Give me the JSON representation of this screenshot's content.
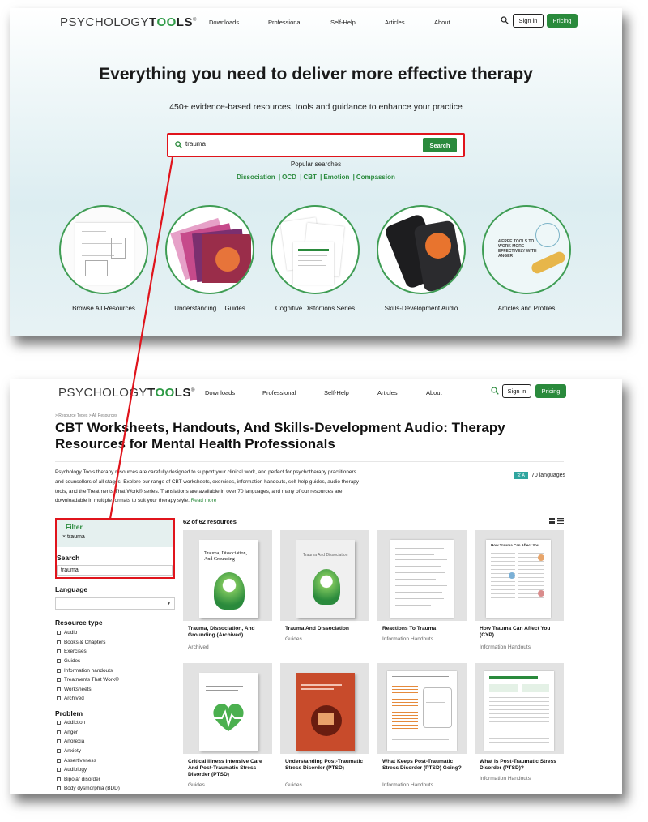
{
  "brand": {
    "logo_thin": "PSYCHOLOGY",
    "logo_bold_a": "T",
    "logo_oo": "OO",
    "logo_bold_b": "LS",
    "reg": "®"
  },
  "nav": {
    "downloads": "Downloads",
    "professional": "Professional",
    "self_help": "Self-Help",
    "articles": "Articles",
    "about": "About",
    "sign_in": "Sign in",
    "pricing": "Pricing"
  },
  "hero": {
    "title": "Everything you need to deliver more effective therapy",
    "subtitle": "450+ evidence-based resources, tools and guidance to enhance your practice",
    "search_value": "trauma",
    "search_button": "Search",
    "popular_label": "Popular searches",
    "popular": [
      "Dissociation",
      "OCD",
      "CBT",
      "Emotion",
      "Compassion"
    ]
  },
  "features": [
    {
      "label": "Browse All Resources"
    },
    {
      "label": "Understanding… Guides"
    },
    {
      "label": "Cognitive Distortions Series"
    },
    {
      "label": "Skills-Development Audio"
    },
    {
      "label": "Articles and Profiles",
      "promo": "4 FREE TOOLS TO WORK MORE EFFECTIVELY WITH ANGER"
    }
  ],
  "results_page": {
    "breadcrumb": "> Resource Types > All Resources",
    "title": "CBT Worksheets, Handouts, And Skills-Development Audio: Therapy Resources for Mental Health Professionals",
    "intro": "Psychology Tools therapy resources are carefully designed to support your clinical work, and perfect for psychotherapy practitioners and counsellors of all stages. Explore our range of CBT worksheets, exercises, information handouts, self-help guides, audio therapy tools, and the Treatments That Work® series. Translations are available in over 70 languages, and many of our resources are downloadable in multiple formats to suit your therapy style.",
    "read_more": "Read more",
    "languages": "70 languages",
    "lang_badge": "文 A",
    "filter_title": "Filter",
    "filter_chip": "× trauma",
    "search_label": "Search",
    "search_value": "trauma",
    "language_label": "Language",
    "resource_type_label": "Resource type",
    "resource_types": [
      "Audio",
      "Books & Chapters",
      "Exercises",
      "Guides",
      "Information handouts",
      "Treatments That Work®",
      "Worksheets",
      "Archived"
    ],
    "problem_label": "Problem",
    "problems": [
      "Addiction",
      "Anger",
      "Anorexia",
      "Anxiety",
      "Assertiveness",
      "Audiology",
      "Bipolar disorder",
      "Body dysmorphia (BDD)"
    ],
    "count": "62 of 62 resources",
    "cards": [
      {
        "title": "Trauma, Dissociation, And Grounding (Archived)",
        "category": "Archived",
        "cover": "Trauma, Dissociation, And Grounding"
      },
      {
        "title": "Trauma And Dissociation",
        "category": "Guides",
        "cover": "Trauma And Dissociation"
      },
      {
        "title": "Reactions To Trauma",
        "category": "Information Handouts"
      },
      {
        "title": "How Trauma Can Affect You (CYP)",
        "category": "Information Handouts",
        "cover": "How Trauma Can Affect You"
      },
      {
        "title": "Critical Illness Intensive Care And Post-Traumatic Stress Disorder (PTSD)",
        "category": "Guides"
      },
      {
        "title": "Understanding Post-Traumatic Stress Disorder (PTSD)",
        "category": "Guides"
      },
      {
        "title": "What Keeps Post-Traumatic Stress Disorder (PTSD) Going?",
        "category": "Information Handouts"
      },
      {
        "title": "What Is Post-Traumatic Stress Disorder (PTSD)?",
        "category": "Information Handouts"
      }
    ]
  },
  "colors": {
    "brand_green": "#2a8a3c",
    "highlight_red": "#e0141c",
    "filter_bg": "#e5f0ef"
  }
}
